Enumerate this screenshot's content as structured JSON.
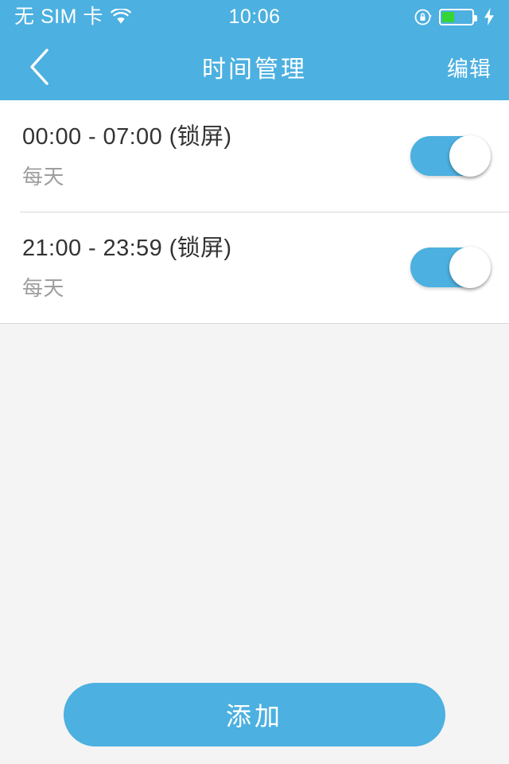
{
  "status_bar": {
    "carrier": "无 SIM 卡",
    "wifi_icon": "wifi-icon",
    "time": "10:06",
    "rotation_lock_icon": "rotation-lock-icon",
    "battery_icon": "battery-icon",
    "battery_level_percent": 42,
    "charging_icon": "lightning-bolt-icon"
  },
  "nav_bar": {
    "back_icon": "chevron-left-icon",
    "title": "时间管理",
    "edit_label": "编辑"
  },
  "list": {
    "rows": [
      {
        "title": "00:00 - 07:00 (锁屏)",
        "subtitle": "每天",
        "enabled": true
      },
      {
        "title": "21:00 - 23:59 (锁屏)",
        "subtitle": "每天",
        "enabled": true
      }
    ]
  },
  "footer": {
    "add_label": "添加"
  },
  "colors": {
    "accent_blue": "#4cb0e0",
    "page_background": "#f4f4f4",
    "row_background": "#ffffff",
    "title_text": "#333333",
    "subtitle_text": "#9e9e9e",
    "divider": "#d8d8d8",
    "battery_green": "#33d633"
  }
}
